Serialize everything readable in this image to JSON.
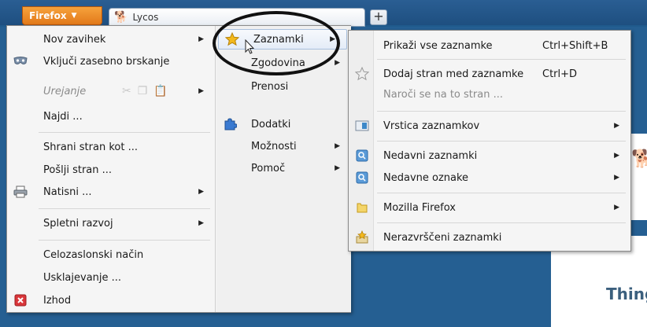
{
  "browser": {
    "app_button": "Firefox",
    "tab_title": "Lycos",
    "new_tab": "+",
    "page_heading": "Thing"
  },
  "main_menu": {
    "left": [
      {
        "label": "Nov zavihek",
        "submenu": true
      },
      {
        "label": "Vključi zasebno brskanje",
        "icon": "private-mask-icon"
      },
      {
        "label": "Urejanje",
        "disabled": true,
        "submenu": true,
        "icons": [
          "cut-icon",
          "copy-icon",
          "paste-icon"
        ]
      },
      {
        "label": "Najdi ..."
      },
      {
        "label": "Shrani stran kot ..."
      },
      {
        "label": "Pošlji stran ..."
      },
      {
        "label": "Natisni ...",
        "icon": "printer-icon",
        "submenu": true
      },
      {
        "label": "Spletni razvoj",
        "submenu": true
      },
      {
        "label": "Celozaslonski način"
      },
      {
        "label": "Usklajevanje ..."
      },
      {
        "label": "Izhod",
        "icon": "exit-icon"
      }
    ],
    "right": [
      {
        "label": "Zaznamki",
        "icon": "star-icon",
        "submenu": true
      },
      {
        "label": "Zgodovina",
        "submenu": true
      },
      {
        "label": "Prenosi"
      },
      {
        "label": "Dodatki",
        "icon": "puzzle-icon"
      },
      {
        "label": "Možnosti",
        "submenu": true
      },
      {
        "label": "Pomoč",
        "submenu": true
      }
    ]
  },
  "bookmarks_menu": {
    "items": [
      {
        "label": "Prikaži vse zaznamke",
        "accel": "Ctrl+Shift+B"
      },
      {
        "label": "Dodaj stran med zaznamke",
        "accel": "Ctrl+D",
        "icon": "star-outline-icon"
      },
      {
        "label": "Naroči se na to stran ...",
        "disabled": true
      },
      {
        "label": "Vrstica zaznamkov",
        "icon": "bookmarks-toolbar-icon",
        "submenu": true
      },
      {
        "label": "Nedavni zaznamki",
        "icon": "smart-folder-icon",
        "submenu": true
      },
      {
        "label": "Nedavne oznake",
        "icon": "smart-folder-icon",
        "submenu": true
      },
      {
        "label": "Mozilla Firefox",
        "icon": "folder-icon",
        "submenu": true
      },
      {
        "label": "Nerazvrščeni zaznamki",
        "icon": "unsorted-bookmarks-icon"
      }
    ]
  },
  "colors": {
    "firefox_button": "#e8841f",
    "menu_bg": "#f5f5f5",
    "highlight_border": "#a8c0de"
  }
}
